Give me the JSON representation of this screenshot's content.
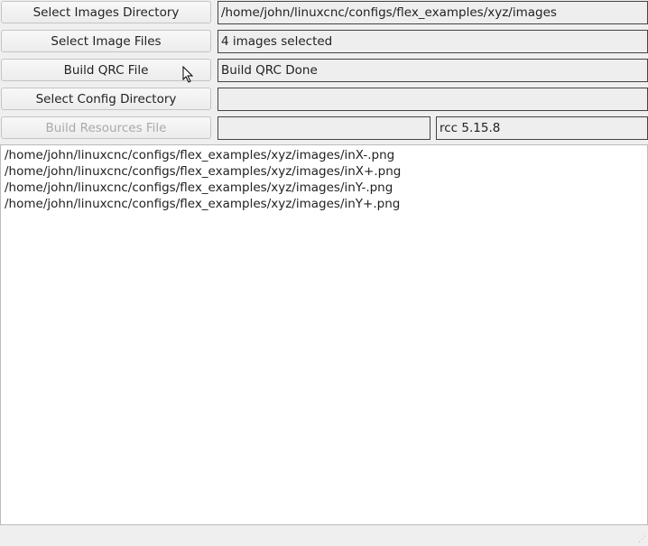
{
  "buttons": {
    "select_images_dir": "Select Images Directory",
    "select_image_files": "Select Image Files",
    "build_qrc": "Build QRC File",
    "select_config_dir": "Select Config Directory",
    "build_resources": "Build Resources File"
  },
  "fields": {
    "images_dir": "/home/john/linuxcnc/configs/flex_examples/xyz/images",
    "image_count": "4 images selected",
    "qrc_status": "Build QRC Done",
    "config_dir": "",
    "resources_file": "",
    "rcc_version": "rcc 5.15.8"
  },
  "files": [
    "/home/john/linuxcnc/configs/flex_examples/xyz/images/inX-.png",
    "/home/john/linuxcnc/configs/flex_examples/xyz/images/inX+.png",
    "/home/john/linuxcnc/configs/flex_examples/xyz/images/inY-.png",
    "/home/john/linuxcnc/configs/flex_examples/xyz/images/inY+.png"
  ]
}
